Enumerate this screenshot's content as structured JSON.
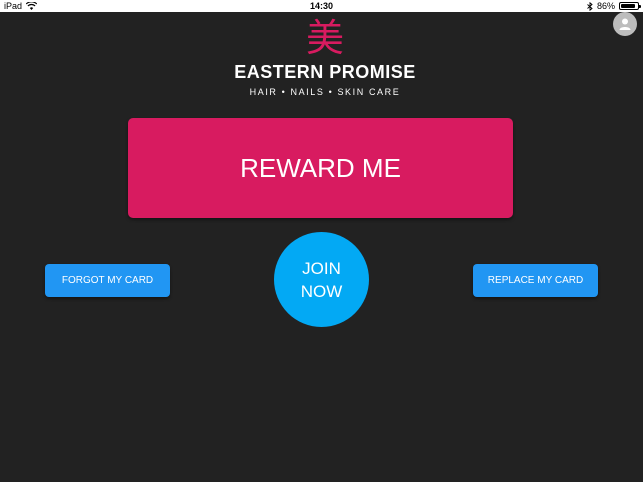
{
  "status_bar": {
    "device": "iPad",
    "time": "14:30",
    "battery_text": "86%",
    "battery_level": 0.86
  },
  "logo": {
    "glyph": "美",
    "name": "EASTERN PROMISE",
    "tagline": "HAIR • NAILS • SKIN CARE"
  },
  "buttons": {
    "reward": "REWARD ME",
    "join_line1": "JOIN",
    "join_line2": "NOW",
    "forgot": "FORGOT MY CARD",
    "replace": "REPLACE MY CARD"
  },
  "icons": {
    "wifi": "wifi-icon",
    "bluetooth": "bluetooth-icon",
    "battery": "battery-icon",
    "profile": "user-avatar-icon"
  },
  "colors": {
    "background": "#222222",
    "reward": "#d81b60",
    "join": "#03a9f4",
    "secondary": "#2196f3"
  }
}
